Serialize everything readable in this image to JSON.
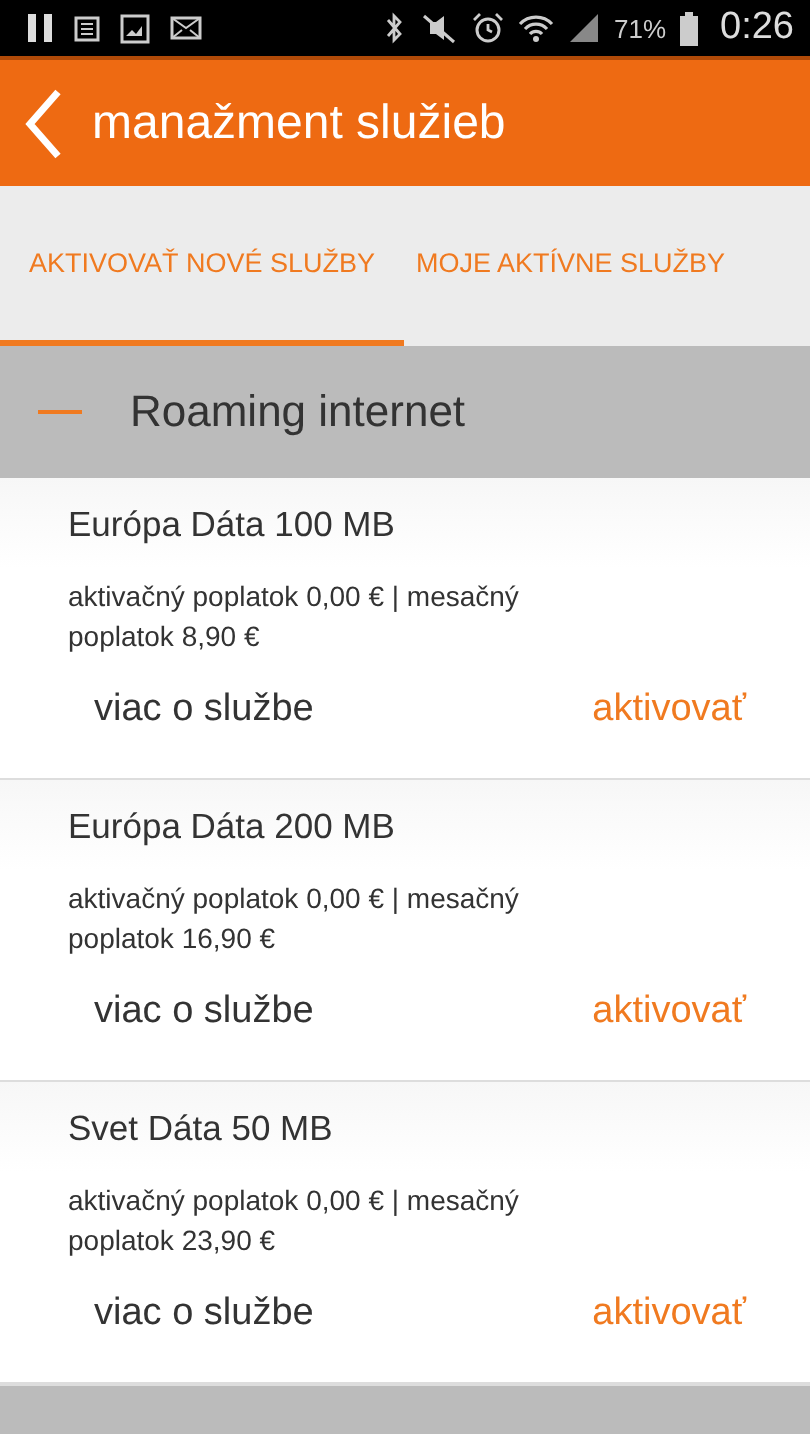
{
  "status_bar": {
    "battery": "71%",
    "time": "0:26"
  },
  "header": {
    "title": "manažment služieb"
  },
  "tabs": [
    {
      "label": "AKTIVOVAŤ NOVÉ SLUŽBY",
      "selected": true
    },
    {
      "label": "MOJE AKTÍVNE SLUŽBY",
      "selected": false
    }
  ],
  "group": {
    "title": "Roaming internet",
    "expanded": true
  },
  "services": [
    {
      "name": "Európa Dáta 100 MB",
      "fees": "aktivačný poplatok 0,00 € | mesačný poplatok 8,90 €",
      "more": "viac o službe",
      "action": "aktivovať"
    },
    {
      "name": "Európa Dáta 200 MB",
      "fees": "aktivačný poplatok 0,00 € | mesačný poplatok 16,90 €",
      "more": "viac o službe",
      "action": "aktivovať"
    },
    {
      "name": "Svet Dáta 50 MB",
      "fees": "aktivačný poplatok 0,00 € | mesačný poplatok 23,90 €",
      "more": "viac o službe",
      "action": "aktivovať"
    }
  ]
}
